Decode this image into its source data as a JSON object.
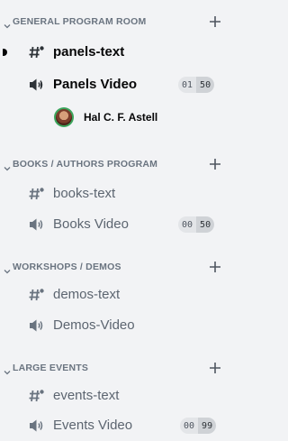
{
  "categories": [
    {
      "label": "GENERAL PROGRAM ROOM",
      "channels": [
        {
          "type": "text",
          "name": "panels-text",
          "bold": true,
          "unread": true
        },
        {
          "type": "voice",
          "name": "Panels Video",
          "bold": true,
          "counter": {
            "current": "01",
            "limit": "50"
          }
        }
      ],
      "voice_user": {
        "name": "Hal C. F. Astell"
      }
    },
    {
      "label": "BOOKS / AUTHORS PROGRAM",
      "channels": [
        {
          "type": "text",
          "name": "books-text"
        },
        {
          "type": "voice",
          "name": "Books Video",
          "counter": {
            "current": "00",
            "limit": "50"
          }
        }
      ]
    },
    {
      "label": "WORKSHOPS / DEMOS",
      "channels": [
        {
          "type": "text",
          "name": "demos-text"
        },
        {
          "type": "voice",
          "name": "Demos-Video"
        }
      ]
    },
    {
      "label": "LARGE EVENTS",
      "channels": [
        {
          "type": "text",
          "name": "events-text"
        },
        {
          "type": "voice",
          "name": "Events Video",
          "counter": {
            "current": "00",
            "limit": "99"
          }
        }
      ]
    }
  ],
  "colors": {
    "background": "#f2f3f5",
    "active_text": "#060607",
    "muted_text": "#5c6570",
    "category_text": "#6a7480",
    "voice_status_green": "#3ba55c"
  },
  "icons": {
    "category_collapse": "chevron-down-icon",
    "category_add": "plus-icon",
    "text_channel": "text-channel-icon",
    "voice_channel": "speaker-icon"
  }
}
